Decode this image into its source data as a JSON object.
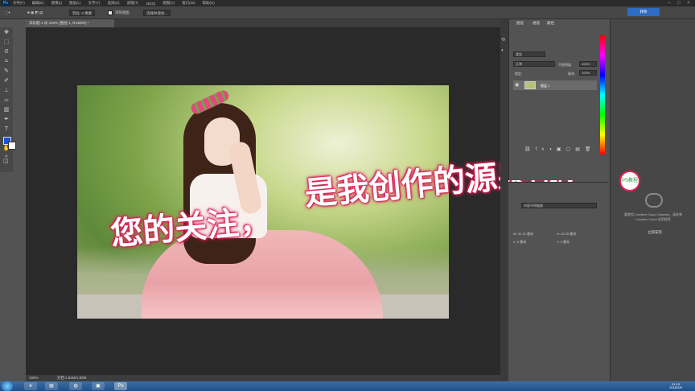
{
  "app": {
    "logo": "Ps"
  },
  "menu": [
    "文件(F)",
    "编辑(E)",
    "图像(I)",
    "图层(L)",
    "文字(Y)",
    "选择(S)",
    "滤镜(T)",
    "3D(D)",
    "视图(V)",
    "窗口(W)",
    "帮助(H)"
  ],
  "options": {
    "feather": "羽化: 0 像素",
    "antialias": "消除锯齿",
    "style": "样式: 正常",
    "select_mask": "选择并遮住..."
  },
  "share": "转移",
  "document": {
    "tab": "未标题-1 @ 100% (图层 1, RGB/8#) *"
  },
  "status": {
    "zoom": "100%",
    "doc_size": "文档:1.82M/1.80M"
  },
  "overlay": {
    "line1": "您的关注，",
    "line2": "是我创作的源泉哦！"
  },
  "layers": {
    "tabs": [
      "图层",
      "通道",
      "路径"
    ],
    "kind": "类型",
    "blend_mode": "正常",
    "opacity_label": "不透明度:",
    "opacity": "100%",
    "lock_label": "锁定:",
    "fill_label": "填充:",
    "fill": "100%",
    "layer_name": "图层 1"
  },
  "properties": {
    "title": "属性",
    "smart_object": "内容不再链接",
    "w": "W: 31.41 厘米",
    "h": "H: 22.25 厘米",
    "x": "X: 0 厘米",
    "y": "Y: 0 厘米"
  },
  "cc": {
    "text": "要使用 Creative Cloud Libraries，请安装 Creative Cloud 应用程序",
    "link": "立即安装",
    "badge": "PS教程"
  },
  "clock": {
    "time": "21:10",
    "date": "2018/2/8"
  }
}
